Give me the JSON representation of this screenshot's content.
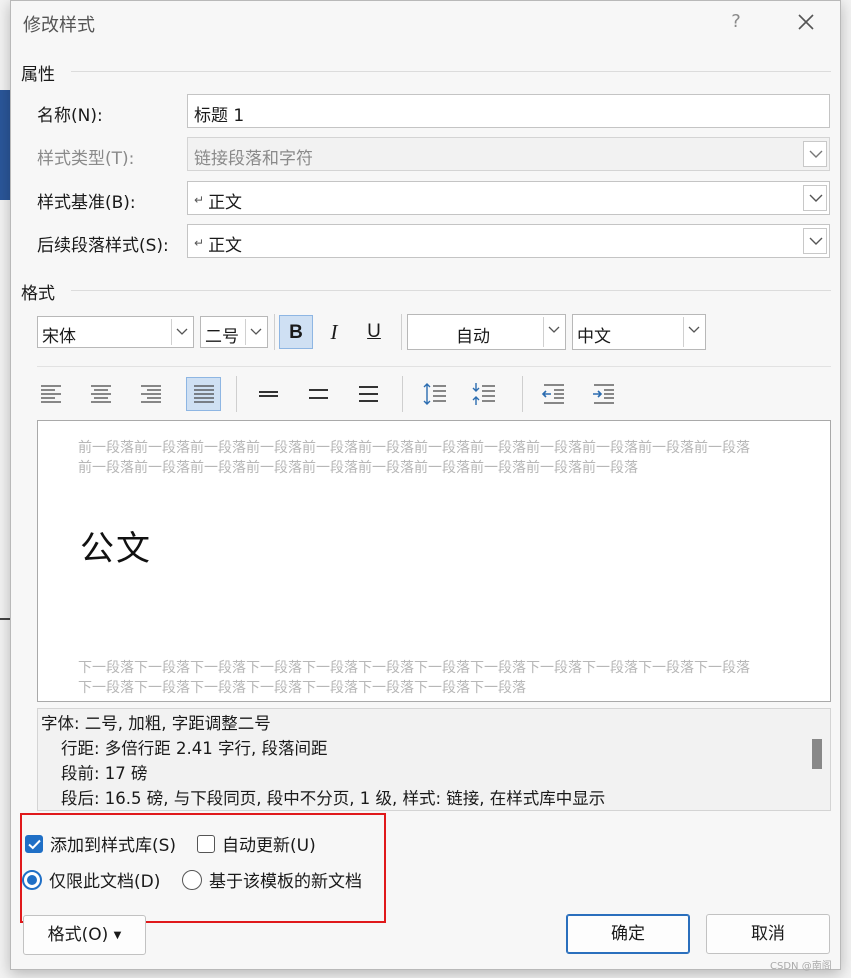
{
  "window": {
    "title": "修改样式",
    "help": "?"
  },
  "properties": {
    "section_label": "属性",
    "name_label": "名称(N):",
    "name_value": "标题 1",
    "style_type_label": "样式类型(T):",
    "style_type_value": "链接段落和字符",
    "based_on_label": "样式基准(B):",
    "based_on_value": "正文",
    "next_style_label": "后续段落样式(S):",
    "next_style_value": "正文"
  },
  "format": {
    "section_label": "格式",
    "font": "宋体",
    "size": "二号",
    "bold": "B",
    "italic": "I",
    "underline": "U",
    "color": "自动",
    "script": "中文"
  },
  "preview": {
    "prev_paragraph": "前一段落前一段落前一段落前一段落前一段落前一段落前一段落前一段落前一段落前一段落前一段落前一段落前一段落前一段落前一段落前一段落前一段落前一段落前一段落前一段落前一段落前一段落",
    "sample": "公文",
    "next_paragraph": "下一段落下一段落下一段落下一段落下一段落下一段落下一段落下一段落下一段落下一段落下一段落下一段落下一段落下一段落下一段落下一段落下一段落下一段落下一段落下一段落"
  },
  "description": {
    "line1": "字体: 二号, 加粗, 字距调整二号",
    "line2": "行距: 多倍行距 2.41 字行, 段落间距",
    "line3": "段前: 17 磅",
    "line4": "段后: 16.5 磅, 与下段同页, 段中不分页, 1 级, 样式: 链接, 在样式库中显示"
  },
  "options": {
    "add_to_gallery": "添加到样式库(S)",
    "auto_update": "自动更新(U)",
    "only_this_doc": "仅限此文档(D)",
    "new_docs_template": "基于该模板的新文档"
  },
  "buttons": {
    "format": "格式(O)",
    "ok": "确定",
    "cancel": "取消"
  },
  "watermark": "CSDN @南阁",
  "colors": {
    "accent": "#1f6fc6",
    "highlight": "#e0191b"
  }
}
